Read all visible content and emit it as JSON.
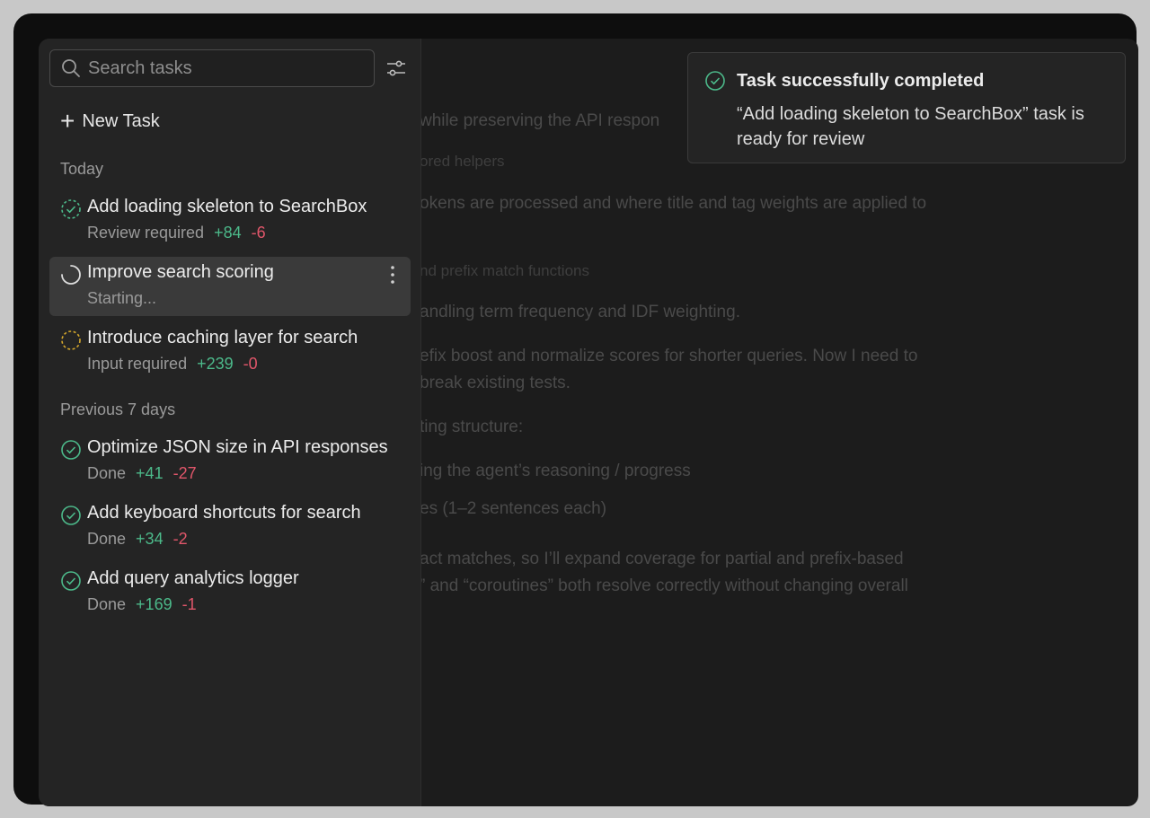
{
  "search": {
    "placeholder": "Search tasks",
    "value": ""
  },
  "sidebar": {
    "new_task_label": "New Task",
    "sections": [
      {
        "label": "Today",
        "tasks": [
          {
            "title": "Add loading skeleton to SearchBox",
            "status": "Review required",
            "status_icon": "review-dashed-circle-icon",
            "additions": "+84",
            "deletions": "-6"
          },
          {
            "title": "Improve search scoring",
            "status": "Starting...",
            "status_icon": "spinner-icon",
            "active": true
          },
          {
            "title": "Introduce caching layer for search",
            "status": "Input required",
            "status_icon": "input-dashed-circle-icon",
            "additions": "+239",
            "deletions": "-0"
          }
        ]
      },
      {
        "label": "Previous 7 days",
        "tasks": [
          {
            "title": "Optimize JSON size in API responses",
            "status": "Done",
            "status_icon": "check-circle-icon",
            "additions": "+41",
            "deletions": "-27"
          },
          {
            "title": "Add keyboard shortcuts for search",
            "status": "Done",
            "status_icon": "check-circle-icon",
            "additions": "+34",
            "deletions": "-2"
          },
          {
            "title": "Add query analytics logger",
            "status": "Done",
            "status_icon": "check-circle-icon",
            "additions": "+169",
            "deletions": "-1"
          }
        ]
      }
    ]
  },
  "toast": {
    "title": "Task successfully completed",
    "body": "“Add loading skeleton to SearchBox” task is ready for review"
  },
  "background": {
    "lines": [
      "while preserving the API respon",
      "ored helpers",
      "okens are processed and where title and tag weights are applied to",
      "nd prefix match functions",
      "andling term frequency and IDF weighting.",
      "efix boost and normalize scores for shorter queries. Now I need to",
      "break existing tests.",
      "ting structure:",
      "ing the agent’s reasoning / progress",
      "es (1–2 sentences each)",
      "act matches, so I’ll expand coverage for partial and prefix-based",
      "” and “coroutines” both resolve correctly without changing overall"
    ]
  },
  "colors": {
    "accent_green": "#4cb98a",
    "deletion_red": "#e0566a",
    "pending_yellow": "#d4a72c"
  }
}
